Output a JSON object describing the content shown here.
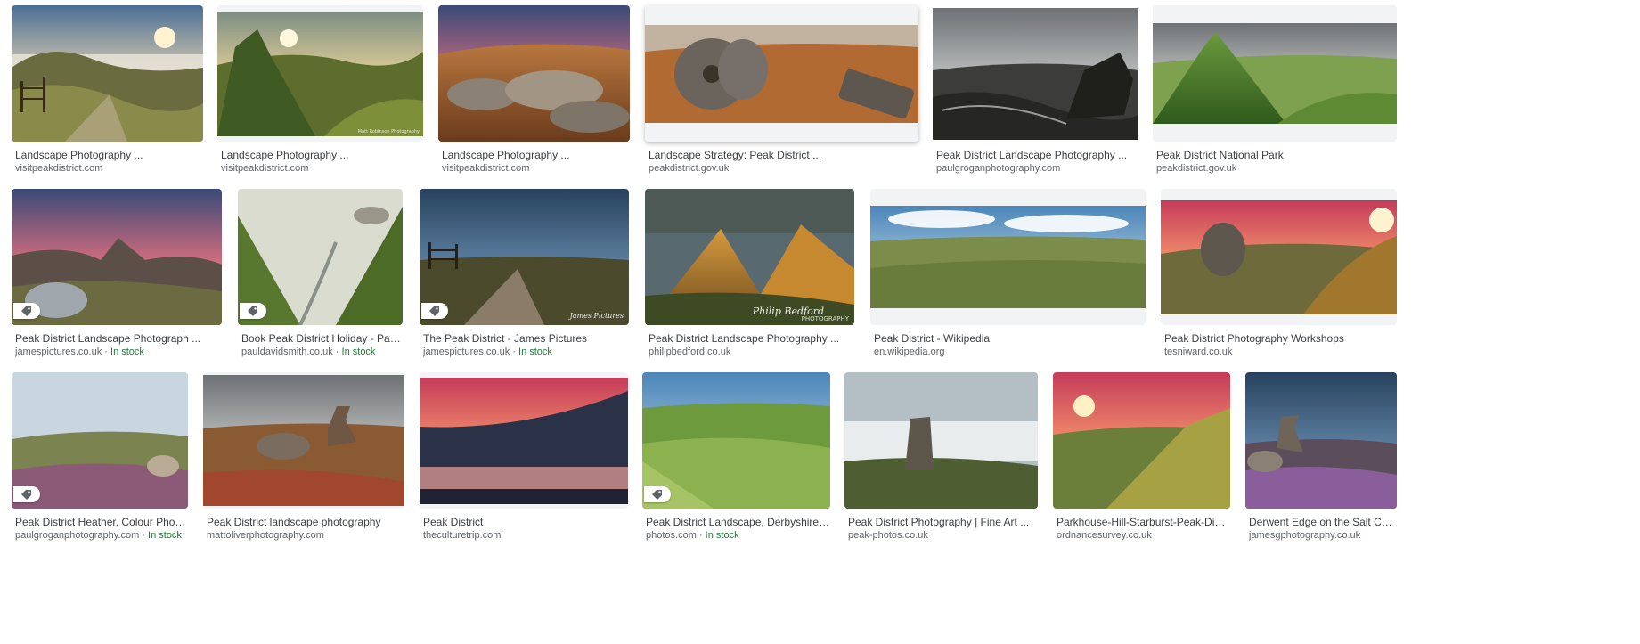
{
  "results": [
    {
      "title": "Landscape Photography ...",
      "source": "visitpeakdistrict.com"
    },
    {
      "title": "Landscape Photography ...",
      "source": "visitpeakdistrict.com"
    },
    {
      "title": "Landscape Photography ...",
      "source": "visitpeakdistrict.com"
    },
    {
      "title": "Landscape Strategy: Peak District ...",
      "source": "peakdistrict.gov.uk"
    },
    {
      "title": "Peak District Landscape Photography ...",
      "source": "paulgroganphotography.com"
    },
    {
      "title": "Peak District National Park",
      "source": "peakdistrict.gov.uk"
    },
    {
      "title": "Peak District Landscape Photograph ...",
      "source": "jamespictures.co.uk",
      "badge": "In stock"
    },
    {
      "title": "Book Peak District Holiday - Paul Da...",
      "source": "pauldavidsmith.co.uk",
      "badge": "In stock"
    },
    {
      "title": "The Peak District - James Pictures",
      "source": "jamespictures.co.uk",
      "badge": "In stock"
    },
    {
      "title": "Peak District Landscape Photography ...",
      "source": "philipbedford.co.uk"
    },
    {
      "title": "Peak District - Wikipedia",
      "source": "en.wikipedia.org"
    },
    {
      "title": "Peak District Photography Workshops",
      "source": "tesniward.co.uk"
    },
    {
      "title": "Peak District Heather, Colour Photogra...",
      "source": "paulgroganphotography.com",
      "badge": "In stock"
    },
    {
      "title": "Peak District landscape photography",
      "source": "mattoliverphotography.com"
    },
    {
      "title": "Peak District",
      "source": "theculturetrip.com"
    },
    {
      "title": "Peak District Landscape, Derbyshire by ...",
      "source": "photos.com",
      "badge": "In stock"
    },
    {
      "title": "Peak District Photography | Fine Art ...",
      "source": "peak-photos.co.uk"
    },
    {
      "title": "Parkhouse-Hill-Starburst-Peak-District ...",
      "source": "ordnancesurvey.co.uk"
    },
    {
      "title": "Derwent Edge on the Salt Cellar ...",
      "source": "jamesgphotography.co.uk"
    }
  ],
  "separator": "·",
  "watermarks": {
    "james_signature": "James Pictures",
    "bedford_signature": "Philip Bedford",
    "bedford_sub": "PHOTOGRAPHY",
    "paul_credit": "Matt Robinson Photography"
  },
  "icons": {
    "tag": "shopping-tag-icon"
  }
}
